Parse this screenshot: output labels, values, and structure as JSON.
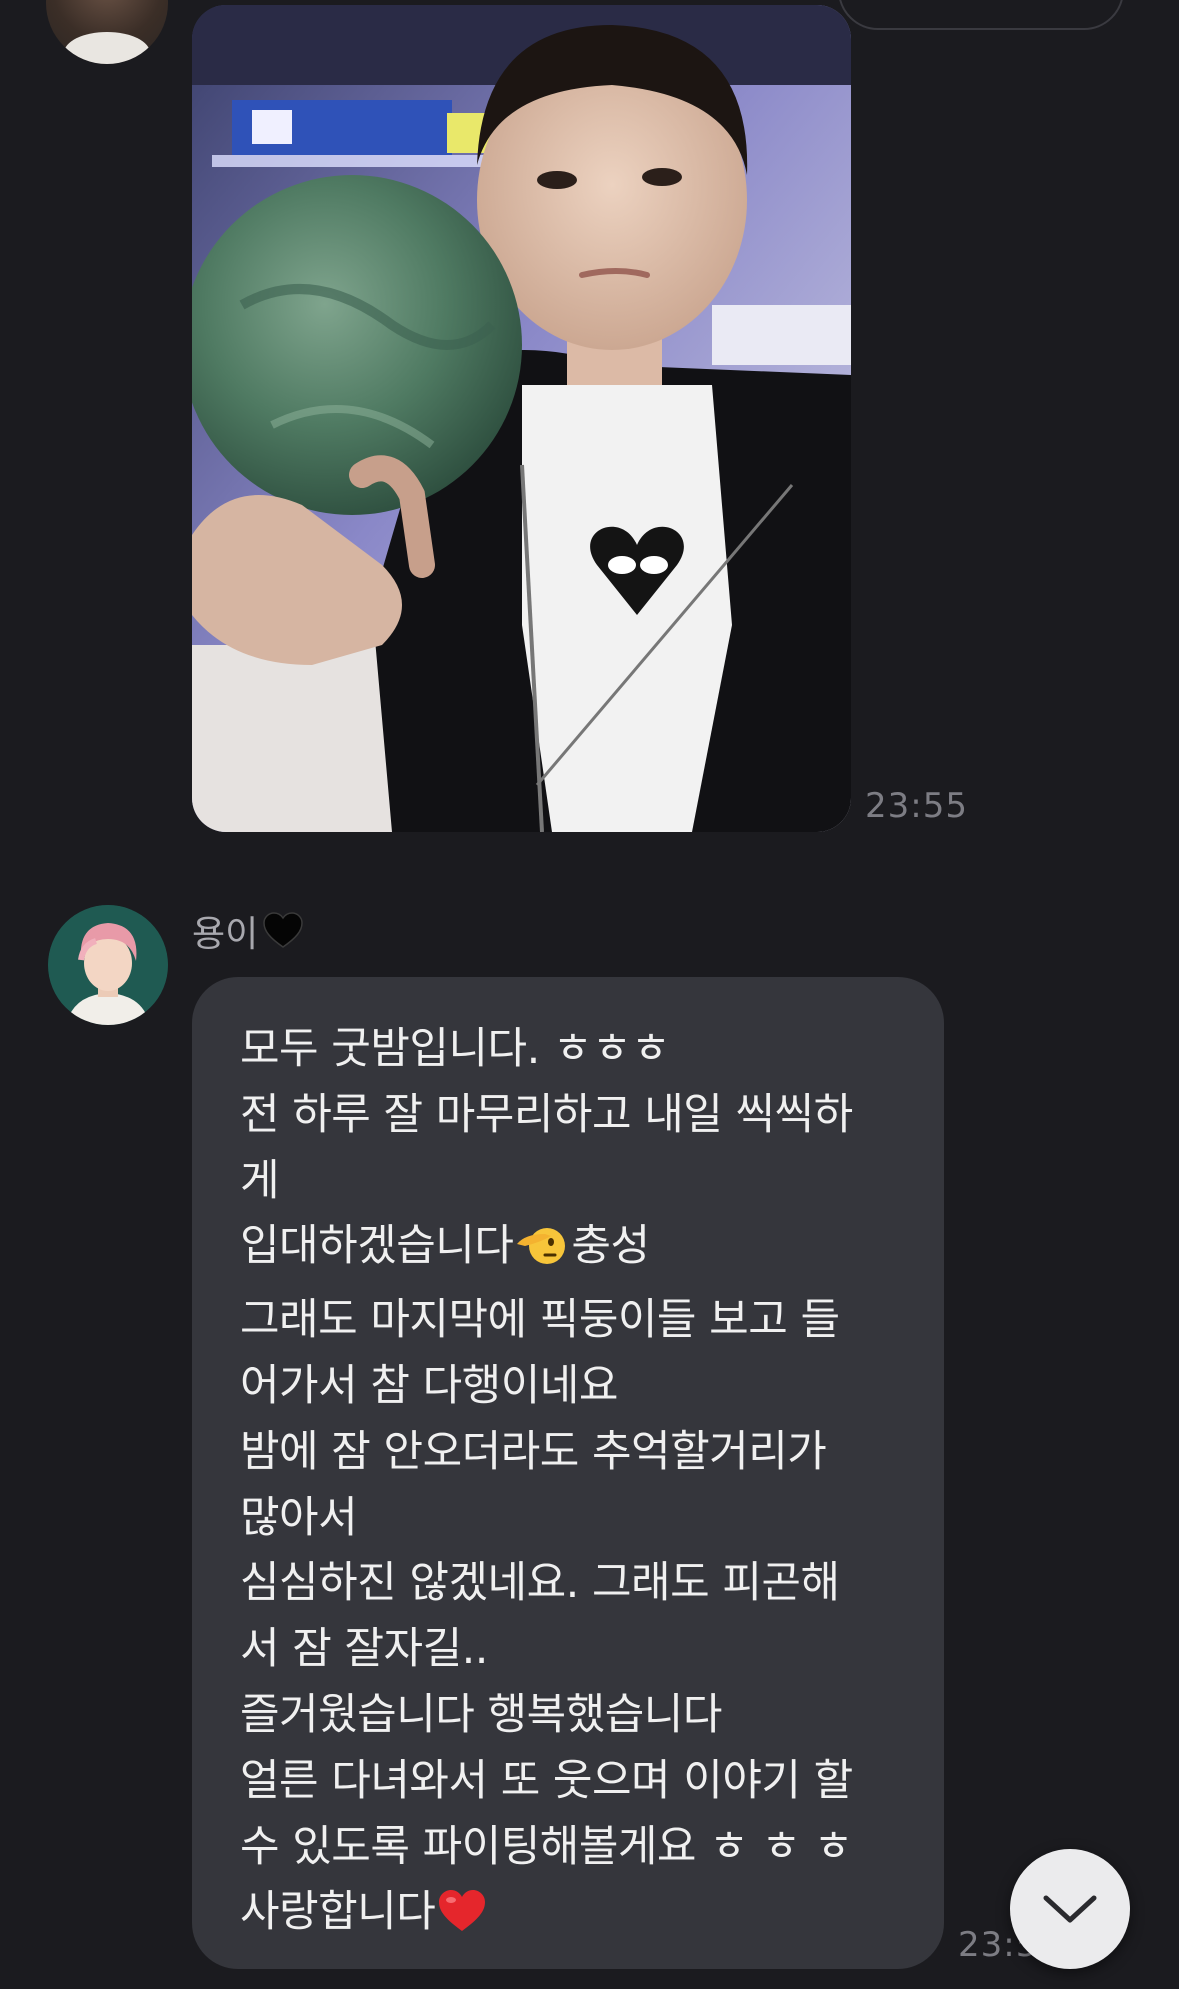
{
  "messages": [
    {
      "type": "image",
      "alt": "photo",
      "time": "23:55"
    },
    {
      "type": "text",
      "sender_name": "용이",
      "sender_icon": "black-heart-icon",
      "lines": [
        "모두 굿밤입니다. ㅎㅎㅎ",
        "전 하루 잘 마무리하고 내일 씩씩하",
        "게",
        "입대하겠습니다",
        "충성",
        "그래도 마지막에 픽둥이들 보고 들",
        "어가서 참 다행이네요",
        "밤에 잠 안오더라도 추억할거리가",
        "많아서",
        "심심하진 않겠네요. 그래도 피곤해",
        "서 잠 잘자길..",
        "즐거웠습니다 행복했습니다",
        "얼른 다녀와서 또 웃으며 이야기 할",
        "수 있도록 파이팅해볼게요 ㅎ ㅎ ㅎ",
        "사랑합니다"
      ],
      "emoji": [
        "saluting-face-icon",
        "red-heart-icon"
      ],
      "time": "23:5"
    }
  ],
  "scroll_button": {
    "icon": "chevron-down-icon"
  },
  "colors": {
    "background": "#1b1b1f",
    "bubble": "#35363c",
    "timestamp": "#7d7d84",
    "heart_red": "#e5262c"
  }
}
